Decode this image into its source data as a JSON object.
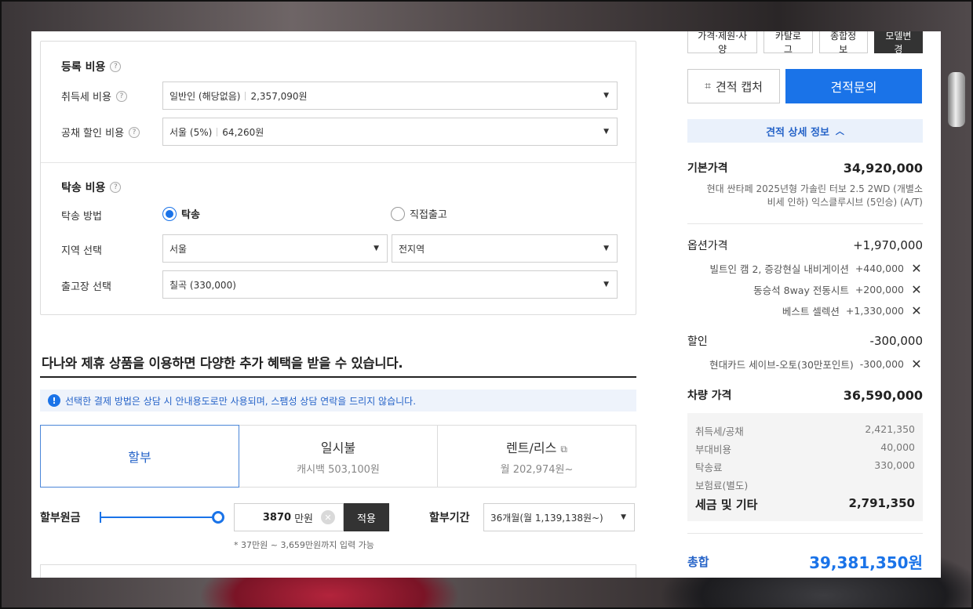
{
  "registration": {
    "title": "등록 비용",
    "acquisition_label": "취득세 비용",
    "acquisition_value": "일반인 (해당없음)",
    "acquisition_amount": "2,357,090원",
    "bond_label": "공채 할인 비용",
    "bond_value": "서울 (5%)",
    "bond_amount": "64,260원"
  },
  "delivery": {
    "title": "탁송 비용",
    "method_label": "탁송 방법",
    "option_delivery": "탁송",
    "option_pickup": "직접출고",
    "region_label": "지역 선택",
    "region_value": "서울",
    "subregion_value": "전지역",
    "factory_label": "출고장 선택",
    "factory_value": "칠곡 (330,000)"
  },
  "promo": {
    "heading": "다나와 제휴 상품을 이용하면 다양한 추가 혜택을 받을 수 있습니다.",
    "notice": "선택한 결제 방법은 상담 시 안내용도로만 사용되며, 스팸성 상담 연락을 드리지 않습니다."
  },
  "payment_tabs": [
    {
      "title": "할부",
      "sub": ""
    },
    {
      "title": "일시불",
      "sub": "캐시백 503,100원"
    },
    {
      "title": "렌트/리스",
      "sub": "월 202,974원~"
    }
  ],
  "loan": {
    "principal_label": "할부원금",
    "amount": "3870",
    "unit": "만원",
    "apply": "적용",
    "hint": "* 37만원 ~ 3,659만원까지 입력 가능",
    "period_label": "할부기간",
    "period_value": "36개월(월 1,139,138원~)",
    "slider_fraction": 1.0
  },
  "summary": {
    "top_buttons": [
      "가격·제원·사양",
      "카탈로그",
      "종합정보",
      "모델변경"
    ],
    "capture": "견적 캡처",
    "inquiry": "견적문의",
    "detail_toggle": "견적 상세 정보",
    "base_label": "기본가격",
    "base_value": "34,920,000",
    "base_desc_1": "현대 싼타페 2025년형 가솔린 터보 2.5 2WD (개별소",
    "base_desc_2": "비세 인하) 익스클루시브 (5인승) (A/T)",
    "option_label": "옵션가격",
    "option_value": "+1,970,000",
    "options": [
      {
        "name": "빌트인 캠 2, 증강현실 내비게이션",
        "price": "+440,000"
      },
      {
        "name": "동승석 8way 전동시트",
        "price": "+200,000"
      },
      {
        "name": "베스트 셀렉션",
        "price": "+1,330,000"
      }
    ],
    "discount_label": "할인",
    "discount_value": "-300,000",
    "discounts": [
      {
        "name": "현대카드 세이브-오토(30만포인트)",
        "price": "-300,000"
      }
    ],
    "vehicle_label": "차량 가격",
    "vehicle_value": "36,590,000",
    "taxes": [
      {
        "name": "취득세/공채",
        "value": "2,421,350"
      },
      {
        "name": "부대비용",
        "value": "40,000"
      },
      {
        "name": "탁송료",
        "value": "330,000"
      },
      {
        "name": "보험료(별도)",
        "value": ""
      }
    ],
    "tax_total_label": "세금 및 기타",
    "tax_total_value": "2,791,350",
    "total_label": "총합",
    "total_value": "39,381,350원"
  },
  "colors": {
    "accent": "#1a73e8",
    "accent_light": "#eaf1fb",
    "dark_button": "#333333"
  }
}
